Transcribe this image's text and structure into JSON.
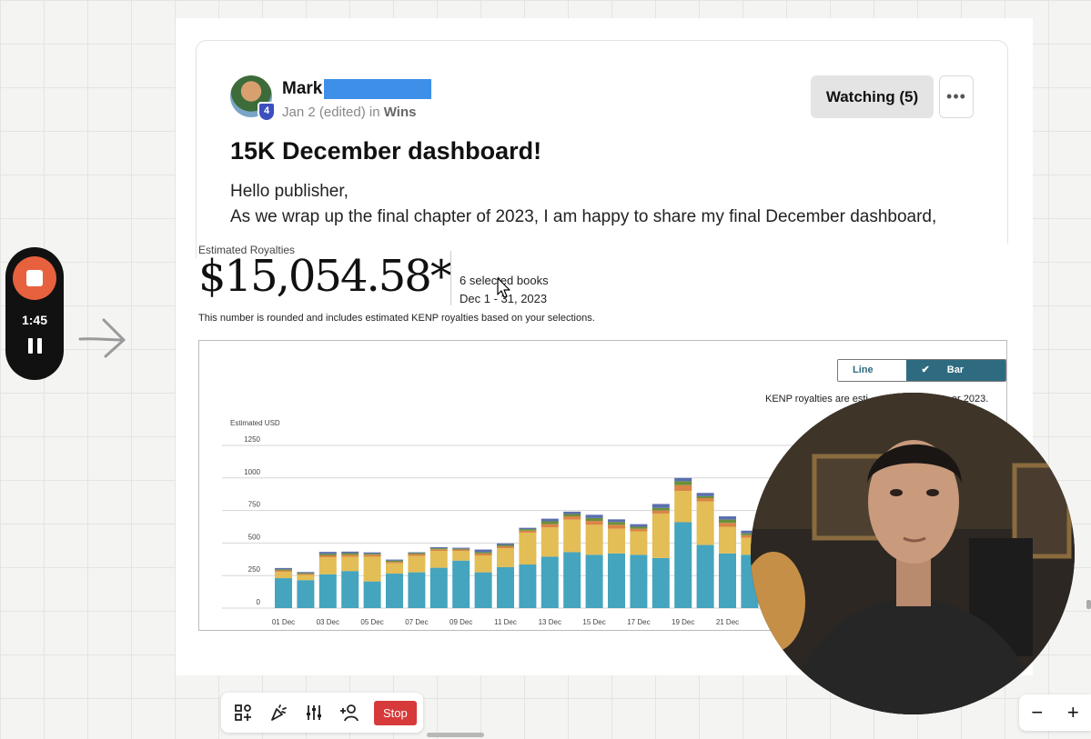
{
  "recorder": {
    "time": "1:45"
  },
  "post": {
    "author": "Mark",
    "avatar_badge": "4",
    "date": "Jan 2 (edited)",
    "in_label": "in",
    "category": "Wins",
    "watch_label": "Watching (5)",
    "more_label": "•••",
    "title": "15K December dashboard!",
    "body_line1": "Hello publisher,",
    "body_line2": "As we wrap up the final chapter of 2023, I am happy to share my final December dashboard,"
  },
  "dashboard": {
    "estimated_label": "Estimated Royalties",
    "amount": "$15,054.58*",
    "books": "6 selected books",
    "date_range": "Dec 1 - 31, 2023",
    "note": "This number is rounded and includes estimated KENP royalties based on your selections.",
    "toggle_line": "Line chart",
    "toggle_bar": "Bar chart",
    "kenp_note": "KENP royalties are esti",
    "kenp_note_end": "er 2023."
  },
  "chart_data": {
    "type": "bar",
    "ylabel": "Estimated USD",
    "ylim": [
      0,
      1250
    ],
    "yticks": [
      0,
      250,
      500,
      750,
      1000,
      1250
    ],
    "grid": true,
    "categories": [
      "01 Dec",
      "02 Dec",
      "03 Dec",
      "04 Dec",
      "05 Dec",
      "06 Dec",
      "07 Dec",
      "08 Dec",
      "09 Dec",
      "10 Dec",
      "11 Dec",
      "12 Dec",
      "13 Dec",
      "14 Dec",
      "15 Dec",
      "16 Dec",
      "17 Dec",
      "18 Dec",
      "19 Dec",
      "20 Dec",
      "21 Dec",
      "22 Dec"
    ],
    "tick_labels": [
      "01 Dec",
      "03 Dec",
      "05 Dec",
      "07 Dec",
      "09 Dec",
      "11 Dec",
      "13 Dec",
      "15 Dec",
      "17 Dec",
      "19 Dec",
      "21 Dec"
    ],
    "colors": [
      "#45a4be",
      "#e3bd55",
      "#d98545",
      "#6a8f3c",
      "#5b6fae"
    ],
    "series": [
      {
        "values": [
          230,
          215,
          260,
          285,
          205,
          265,
          275,
          310,
          365,
          275,
          315,
          335,
          395,
          430,
          410,
          420,
          410,
          385,
          660,
          485,
          420,
          410
        ]
      },
      {
        "values": [
          50,
          40,
          130,
          110,
          190,
          80,
          125,
          130,
          75,
          130,
          145,
          245,
          225,
          250,
          230,
          190,
          180,
          340,
          240,
          335,
          205,
          130
        ]
      },
      {
        "values": [
          10,
          8,
          15,
          15,
          15,
          10,
          15,
          12,
          10,
          15,
          15,
          15,
          25,
          25,
          30,
          30,
          20,
          25,
          45,
          25,
          30,
          20
        ]
      },
      {
        "values": [
          8,
          6,
          12,
          12,
          8,
          10,
          8,
          8,
          6,
          10,
          10,
          12,
          22,
          18,
          22,
          22,
          15,
          20,
          30,
          15,
          25,
          15
        ]
      },
      {
        "values": [
          10,
          8,
          15,
          12,
          10,
          8,
          6,
          8,
          8,
          20,
          12,
          10,
          20,
          18,
          25,
          20,
          20,
          30,
          25,
          25,
          25,
          20
        ]
      }
    ]
  },
  "toolbar": {
    "stop_label": "Stop"
  },
  "zoom": {
    "minus": "−",
    "plus": "+"
  }
}
